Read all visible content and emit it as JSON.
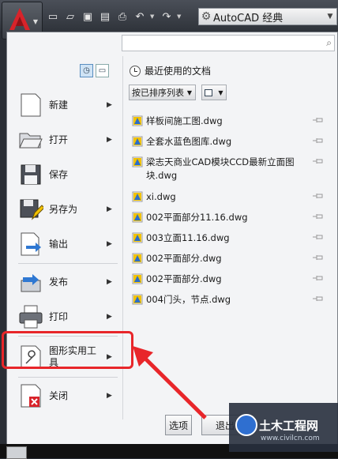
{
  "titlebar": {
    "app_button_icon": "autocad-logo-icon",
    "workspace": "AutoCAD 经典",
    "qat_icons": [
      "new-icon",
      "open-icon",
      "save-icon",
      "save-as-icon",
      "print-icon",
      "undo-icon",
      "redo-icon"
    ]
  },
  "search": {
    "placeholder": ""
  },
  "menu": {
    "items": [
      {
        "label": "新建",
        "icon": "new-file-icon",
        "has_arrow": true
      },
      {
        "label": "打开",
        "icon": "open-folder-icon",
        "has_arrow": true
      },
      {
        "label": "保存",
        "icon": "save-disk-icon",
        "has_arrow": false
      },
      {
        "label": "另存为",
        "icon": "save-as-icon",
        "has_arrow": true
      },
      {
        "label": "输出",
        "icon": "export-icon",
        "has_arrow": true
      },
      {
        "label": "发布",
        "icon": "publish-icon",
        "has_arrow": true
      },
      {
        "label": "打印",
        "icon": "printer-icon",
        "has_arrow": true
      },
      {
        "label": "图形实用工\n具",
        "icon": "wrench-icon",
        "has_arrow": true
      },
      {
        "label": "关闭",
        "icon": "close-document-icon",
        "has_arrow": true
      }
    ]
  },
  "recent": {
    "title": "最近使用的文档",
    "sort_label": "按已排序列表",
    "files": [
      "样板间施工图.dwg",
      "全套水蓝色图库.dwg",
      "梁志天商业CAD模块CCD最新立面图块.dwg",
      "xi.dwg",
      "002平面部分11.16.dwg",
      "003立面11.16.dwg",
      "002平面部分.dwg",
      "002平面部分.dwg",
      "004门头，节点.dwg"
    ]
  },
  "footer": {
    "options": "选项",
    "exit": "退出"
  },
  "watermark": {
    "title": "土木工程网",
    "url": "www.civilcn.com"
  },
  "colors": {
    "highlight": "#e8262a",
    "accent_blue": "#2f6fd0"
  }
}
